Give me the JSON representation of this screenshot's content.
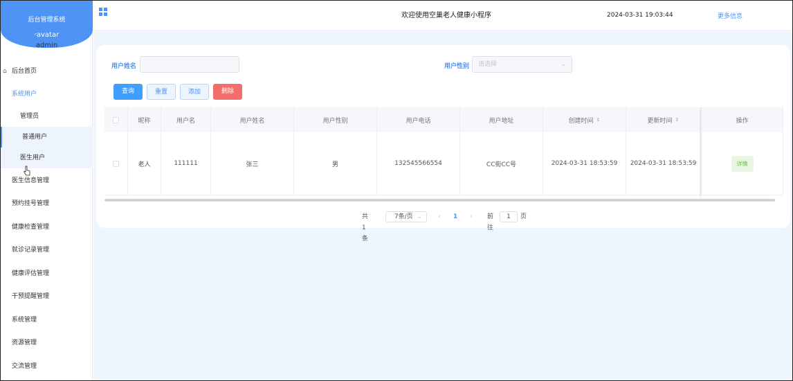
{
  "brand": {
    "title": "后台管理系统",
    "avatar_alt": "avatar",
    "username": "admin"
  },
  "sidebar": {
    "home": "后台首页",
    "system_users": "系统用户",
    "sub_items": [
      "管理员",
      "普通用户",
      "医生用户"
    ],
    "items": [
      "医生信息管理",
      "预约挂号管理",
      "健康检查管理",
      "就诊记录管理",
      "健康评估管理",
      "干预提醒管理",
      "系统管理",
      "资源管理",
      "交流管理"
    ]
  },
  "header": {
    "welcome": "欢迎使用空巢老人健康小程序",
    "datetime": "2024-03-31 19:03:44",
    "more": "更多信息"
  },
  "search": {
    "name_label": "用户姓名",
    "name_value": "",
    "gender_label": "用户性别",
    "gender_placeholder": "请选择"
  },
  "buttons": {
    "query": "查询",
    "reset": "重置",
    "add": "添加",
    "delete": "删除"
  },
  "table": {
    "headers": [
      "昵称",
      "用户名",
      "用户姓名",
      "用户性别",
      "用户电话",
      "用户地址",
      "创建时间",
      "更新时间",
      "操作"
    ],
    "rows": [
      [
        "老人",
        "111111",
        "张三",
        "男",
        "132545566554",
        "CC街CC号",
        "2024-03-31 18:53:59",
        "2024-03-31 18:53:59",
        "详情"
      ]
    ]
  },
  "pagination": {
    "total": "共 1 条",
    "page_size": "7条/页",
    "prev": "‹",
    "current": "1",
    "next": "›",
    "goto_label": "前往",
    "goto_value": "1",
    "page_unit": "页"
  },
  "colors": {
    "accent": "#4f93f7",
    "danger": "#f56c6c",
    "success": "#67c23a",
    "background": "#eef5fd"
  }
}
